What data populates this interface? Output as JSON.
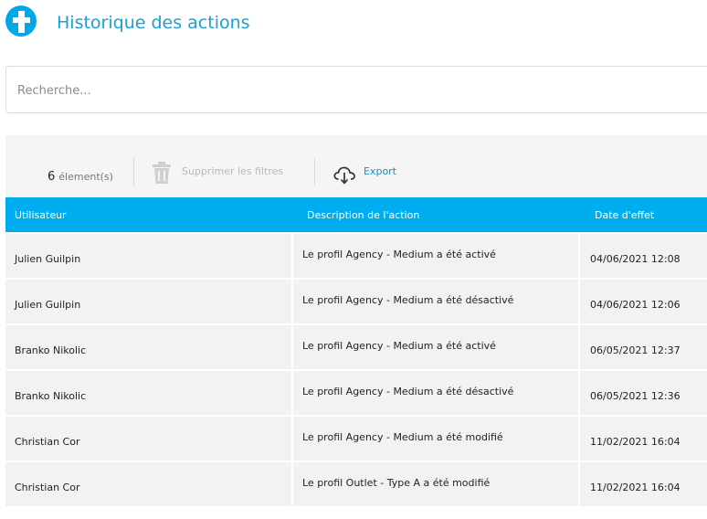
{
  "header": {
    "title": "Historique des actions",
    "logo_icon": "plus-circle-icon",
    "accent_color": "#00aeef"
  },
  "search": {
    "placeholder": "Recherche...",
    "value": ""
  },
  "toolbar": {
    "count_value": "6",
    "count_label": "élement(s)",
    "clear_filters_label": "Supprimer les filtres",
    "clear_filters_icon": "trash-icon",
    "export_label": "Export",
    "export_icon": "cloud-download-icon"
  },
  "table": {
    "columns": [
      "Utilisateur",
      "Description de l'action",
      "Date d'effet"
    ],
    "rows": [
      {
        "user": "Julien Guilpin",
        "description": "Le profil Agency - Medium a été activé",
        "date": "04/06/2021 12:08"
      },
      {
        "user": "Julien Guilpin",
        "description": "Le profil Agency - Medium a été désactivé",
        "date": "04/06/2021 12:06"
      },
      {
        "user": "Branko Nikolic",
        "description": "Le profil Agency - Medium a été activé",
        "date": "06/05/2021 12:37"
      },
      {
        "user": "Branko Nikolic",
        "description": "Le profil Agency - Medium a été désactivé",
        "date": "06/05/2021 12:36"
      },
      {
        "user": "Christian Cor",
        "description": "Le profil Agency - Medium a été modifié",
        "date": "11/02/2021 16:04"
      },
      {
        "user": "Christian Cor",
        "description": "Le profil Outlet - Type A a été modifié",
        "date": "11/02/2021 16:04"
      }
    ]
  }
}
